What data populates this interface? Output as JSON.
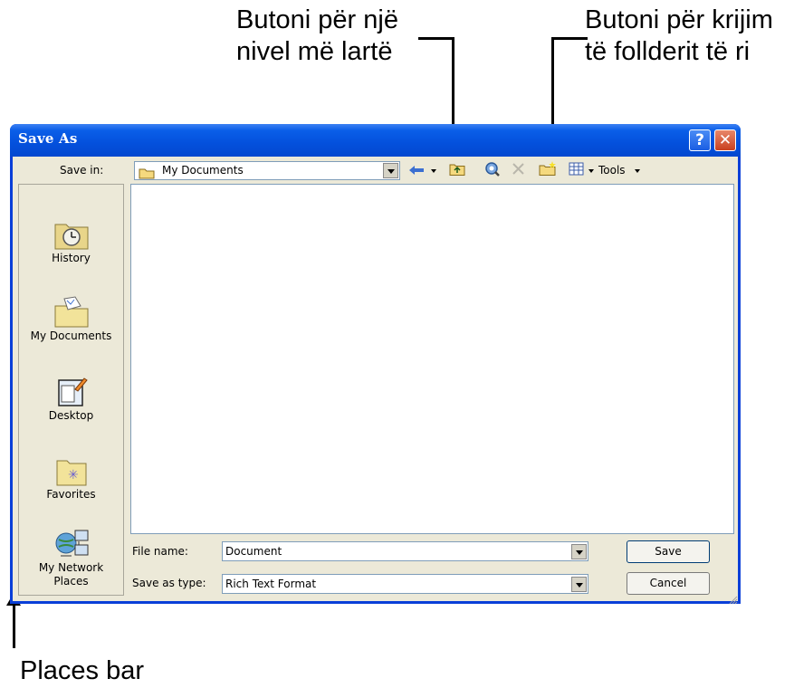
{
  "annotations": {
    "up_level": [
      "Butoni për një",
      "nivel më lartë"
    ],
    "new_folder": [
      "Butoni për krijim",
      "të follderit të ri"
    ],
    "places_bar": "Places bar"
  },
  "dialog": {
    "title": "Save As",
    "help_label": "?",
    "close_label": "✕",
    "save_in_label": "Save in:",
    "save_in_value": "My Documents",
    "tools_label": "Tools",
    "places": [
      {
        "label": "History",
        "icon": "history-icon"
      },
      {
        "label": "My Documents",
        "icon": "my-documents-icon"
      },
      {
        "label": "Desktop",
        "icon": "desktop-icon"
      },
      {
        "label": "Favorites",
        "icon": "favorites-icon"
      },
      {
        "label": "My Network Places",
        "icon": "network-places-icon"
      }
    ],
    "file_name_label": "File name:",
    "file_name_value": "Document",
    "save_as_type_label": "Save as type:",
    "save_as_type_value": "Rich Text Format",
    "save_button": "Save",
    "cancel_button": "Cancel"
  },
  "colors": {
    "titlebar": "#0450dc",
    "client": "#ece9d8",
    "border": "#7f9db9"
  }
}
